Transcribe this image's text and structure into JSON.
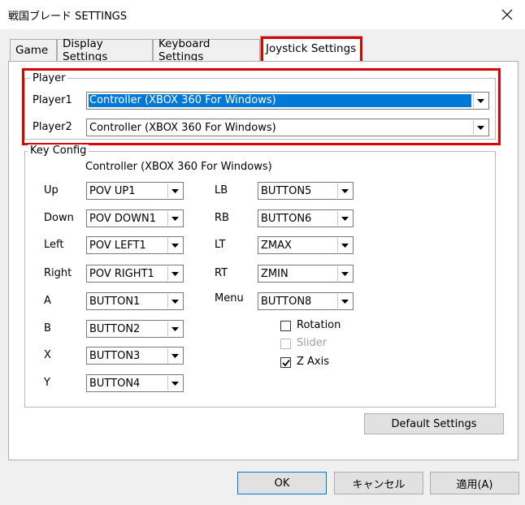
{
  "window": {
    "title": "戦国ブレード SETTINGS"
  },
  "tabs": [
    "Game",
    "Display Settings",
    "Keyboard Settings",
    "Joystick Settings"
  ],
  "player_group": {
    "label": "Player",
    "player1_label": "Player1",
    "player1_value": "Controller (XBOX 360 For Windows)",
    "player2_label": "Player2",
    "player2_value": "Controller (XBOX 360 For Windows)"
  },
  "key_config": {
    "label": "Key Config",
    "controller_name": "Controller (XBOX 360 For Windows)",
    "left_keys": [
      {
        "label": "Up",
        "value": "POV UP1"
      },
      {
        "label": "Down",
        "value": "POV DOWN1"
      },
      {
        "label": "Left",
        "value": "POV LEFT1"
      },
      {
        "label": "Right",
        "value": "POV RIGHT1"
      },
      {
        "label": "A",
        "value": "BUTTON1"
      },
      {
        "label": "B",
        "value": "BUTTON2"
      },
      {
        "label": "X",
        "value": "BUTTON3"
      },
      {
        "label": "Y",
        "value": "BUTTON4"
      }
    ],
    "right_keys": [
      {
        "label": "LB",
        "value": "BUTTON5"
      },
      {
        "label": "RB",
        "value": "BUTTON6"
      },
      {
        "label": "LT",
        "value": "ZMAX"
      },
      {
        "label": "RT",
        "value": "ZMIN"
      },
      {
        "label": "Menu",
        "value": "BUTTON8"
      }
    ],
    "checkboxes": [
      {
        "label": "Rotation",
        "checked": false,
        "enabled": true
      },
      {
        "label": "Slider",
        "checked": false,
        "enabled": false
      },
      {
        "label": "Z Axis",
        "checked": true,
        "enabled": true
      }
    ]
  },
  "buttons": {
    "default_settings": "Default Settings",
    "ok": "OK",
    "cancel": "キャンセル",
    "apply": "適用(A)"
  },
  "colors": {
    "highlight": "#e00000",
    "selection": "#0078d7"
  }
}
